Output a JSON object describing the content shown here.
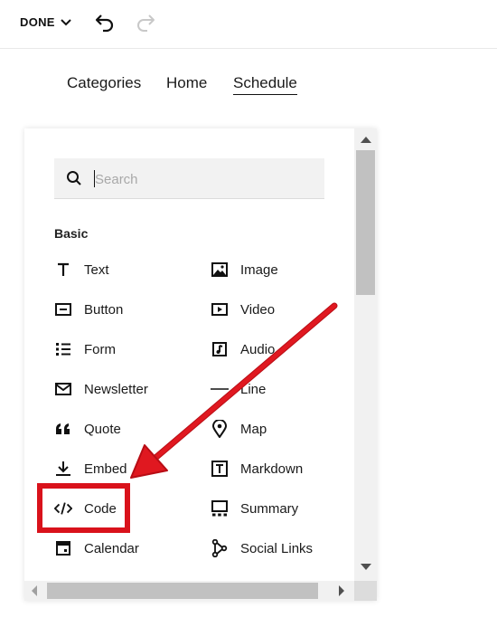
{
  "toolbar": {
    "done_label": "DONE",
    "icons": [
      "chevron-down-icon",
      "undo-icon",
      "redo-icon"
    ]
  },
  "nav": {
    "items": [
      {
        "label": "Categories"
      },
      {
        "label": "Home"
      },
      {
        "label": "Schedule"
      }
    ],
    "active": "Schedule"
  },
  "panel": {
    "search": {
      "placeholder": "Search",
      "value": ""
    },
    "section_title": "Basic",
    "blocks_left": [
      {
        "label": "Text",
        "icon": "text-icon"
      },
      {
        "label": "Button",
        "icon": "button-icon"
      },
      {
        "label": "Form",
        "icon": "form-icon"
      },
      {
        "label": "Newsletter",
        "icon": "envelope-icon"
      },
      {
        "label": "Quote",
        "icon": "quote-icon"
      },
      {
        "label": "Embed",
        "icon": "download-icon"
      },
      {
        "label": "Code",
        "icon": "code-icon"
      },
      {
        "label": "Calendar",
        "icon": "calendar-icon"
      }
    ],
    "blocks_right": [
      {
        "label": "Image",
        "icon": "image-icon"
      },
      {
        "label": "Video",
        "icon": "video-icon"
      },
      {
        "label": "Audio",
        "icon": "audio-icon"
      },
      {
        "label": "Line",
        "icon": "line-icon"
      },
      {
        "label": "Map",
        "icon": "map-pin-icon"
      },
      {
        "label": "Markdown",
        "icon": "markdown-icon"
      },
      {
        "label": "Summary",
        "icon": "summary-icon"
      },
      {
        "label": "Social Links",
        "icon": "social-links-icon"
      }
    ]
  },
  "annotation": {
    "highlight_color": "#d9121b",
    "highlighted_item": "Code"
  }
}
